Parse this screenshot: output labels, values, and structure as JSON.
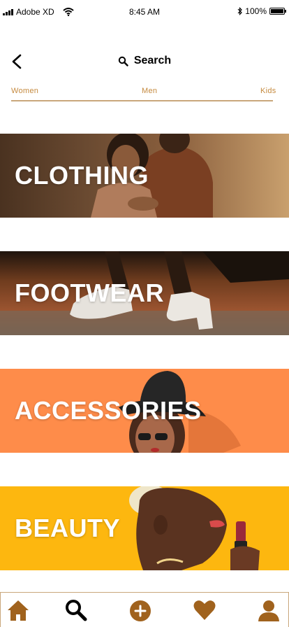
{
  "status_bar": {
    "carrier": "Adobe XD",
    "time": "8:45 AM",
    "battery": "100%",
    "battery_level": 1.0,
    "icons": [
      "signal-icon",
      "wifi-icon",
      "bluetooth-icon",
      "battery-icon"
    ]
  },
  "header": {
    "back_icon": "chevron-left-icon",
    "search_icon": "search-icon",
    "title": "Search"
  },
  "tabs": [
    {
      "label": "Women"
    },
    {
      "label": "Men"
    },
    {
      "label": "Kids"
    }
  ],
  "categories": [
    {
      "label": "CLOTHING"
    },
    {
      "label": "FOOTWEAR"
    },
    {
      "label": "ACCESSORIES"
    },
    {
      "label": "BEAUTY"
    }
  ],
  "bottom_nav": [
    {
      "icon": "home-icon"
    },
    {
      "icon": "search-icon"
    },
    {
      "icon": "add-circle-icon"
    },
    {
      "icon": "heart-icon"
    },
    {
      "icon": "profile-icon"
    }
  ],
  "colors": {
    "accent": "#a0621d",
    "tab_text": "#c58a3f",
    "accessories_bg": "#fe8c4a",
    "beauty_bg": "#fdb70f"
  }
}
